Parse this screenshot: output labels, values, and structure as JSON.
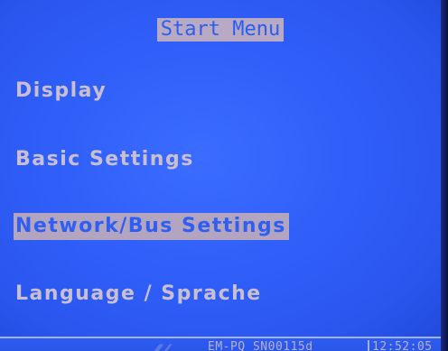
{
  "header": {
    "title": "Start Menu"
  },
  "menu": {
    "items": [
      {
        "label": "Display",
        "selected": false
      },
      {
        "label": "Basic Settings",
        "selected": false
      },
      {
        "label": "Network/Bus Settings",
        "selected": true
      },
      {
        "label": "Language / Sprache",
        "selected": false
      }
    ]
  },
  "status_bar": {
    "icon": "wireless-signal-icon",
    "device_text": "EM-PQ SN00115d",
    "time": "12:52:05"
  },
  "colors": {
    "background": "#2f5ef8",
    "text": "#c9bfd0",
    "highlight": "#b3a5bf"
  }
}
